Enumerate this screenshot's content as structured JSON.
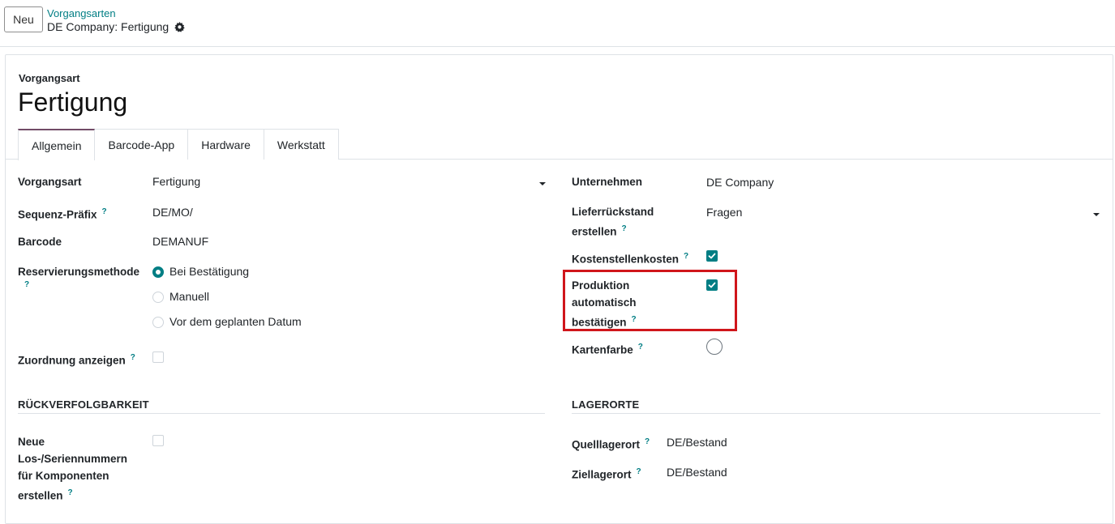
{
  "control_panel": {
    "new_button": "Neu",
    "breadcrumb_parent": "Vorgangsarten",
    "breadcrumb_current": "DE Company: Fertigung"
  },
  "record": {
    "type_label": "Vorgangsart",
    "title": "Fertigung"
  },
  "tabs": [
    {
      "label": "Allgemein",
      "active": true
    },
    {
      "label": "Barcode-App"
    },
    {
      "label": "Hardware"
    },
    {
      "label": "Werkstatt"
    }
  ],
  "help_marker": "?",
  "left": {
    "vorgangsart": {
      "label": "Vorgangsart",
      "value": "Fertigung"
    },
    "sequenz_praefix": {
      "label": "Sequenz-Präfix",
      "value": "DE/MO/"
    },
    "barcode": {
      "label": "Barcode",
      "value": "DEMANUF"
    },
    "reservierungsmethode": {
      "label": "Reservierungsmethode",
      "options": [
        "Bei Bestätigung",
        "Manuell",
        "Vor dem geplanten Datum"
      ],
      "selected": "Bei Bestätigung"
    },
    "zuordnung_anzeigen": {
      "label": "Zuordnung anzeigen",
      "checked": false
    }
  },
  "right": {
    "unternehmen": {
      "label": "Unternehmen",
      "value": "DE Company"
    },
    "lieferrueckstand": {
      "label_line1": "Lieferrückstand",
      "label_line2": "erstellen",
      "value": "Fragen"
    },
    "kostenstellenkosten": {
      "label": "Kostenstellenkosten",
      "checked": true
    },
    "produktion_auto": {
      "label_line1": "Produktion",
      "label_line2": "automatisch",
      "label_line3": "bestätigen",
      "checked": true
    },
    "kartenfarbe": {
      "label": "Kartenfarbe"
    }
  },
  "sections": {
    "traceability": {
      "title": "RÜCKVERFOLGBARKEIT",
      "lot_field": {
        "label_line1": "Neue",
        "label_line2": "Los-/Seriennummern",
        "label_line3": "für Komponenten",
        "label_line4": "erstellen",
        "checked": false
      }
    },
    "locations": {
      "title": "LAGERORTE",
      "source": {
        "label": "Quelllagerort",
        "value": "DE/Bestand"
      },
      "dest": {
        "label": "Ziellagerort",
        "value": "DE/Bestand"
      }
    }
  },
  "colors": {
    "accent": "#017e84",
    "tab_active": "#714b67",
    "highlight": "#d0161b"
  }
}
